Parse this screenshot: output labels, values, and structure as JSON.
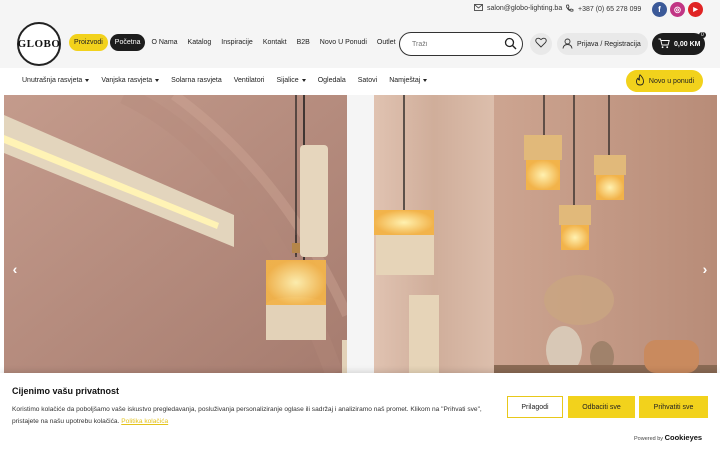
{
  "topbar": {
    "email": "salon@globo-lighting.ba",
    "phone": "+387 (0) 65 278 099",
    "social": [
      {
        "name": "facebook",
        "glyph": "f",
        "color": "#3b5998"
      },
      {
        "name": "instagram",
        "glyph": "◎",
        "color": "#c13584"
      },
      {
        "name": "youtube",
        "glyph": "▶",
        "color": "#e02424"
      }
    ]
  },
  "header": {
    "logo_text": "GLOBO",
    "nav": [
      {
        "label": "Proizvodi",
        "style": "yellow"
      },
      {
        "label": "Početna",
        "style": "dark"
      },
      {
        "label": "O Nama",
        "style": ""
      },
      {
        "label": "Katalog",
        "style": ""
      },
      {
        "label": "Inspiracije",
        "style": ""
      },
      {
        "label": "Kontakt",
        "style": ""
      },
      {
        "label": "B2B",
        "style": ""
      },
      {
        "label": "Novo U Ponudi",
        "style": ""
      },
      {
        "label": "Outlet",
        "style": ""
      }
    ],
    "search_placeholder": "Traži",
    "login_label": "Prijava / Registracija",
    "cart_label": "0,00 KM",
    "cart_count": "0"
  },
  "categories": [
    {
      "label": "Unutrašnja rasvjeta",
      "dropdown": true
    },
    {
      "label": "Vanjska rasvjeta",
      "dropdown": true
    },
    {
      "label": "Solarna rasvjeta",
      "dropdown": false
    },
    {
      "label": "Ventilatori",
      "dropdown": false
    },
    {
      "label": "Sijalice",
      "dropdown": true
    },
    {
      "label": "Ogledala",
      "dropdown": false
    },
    {
      "label": "Satovi",
      "dropdown": false
    },
    {
      "label": "Namještaj",
      "dropdown": true
    }
  ],
  "novo_button": "Novo u ponudi",
  "colors": {
    "accent": "#f2d21c",
    "dark": "#1d1d1d",
    "hero_left": "#b78e7f",
    "hero_right": "#c79a84"
  },
  "cookie": {
    "title": "Cijenimo vašu privatnost",
    "text": "Koristimo kolačiće da poboljšamo vaše iskustvo pregledavanja, posluživanja personaliziranje oglase ili sadržaj i analiziramo naš promet. Klikom na \"Prihvati sve\", pristajete na našu upotrebu kolačića.",
    "policy_link": "Politika kolačića",
    "customize": "Prilagodi",
    "reject": "Odbaciti sve",
    "accept": "Prihvatiti sve",
    "powered_prefix": "Powered by",
    "powered_brand": "Cookieyes"
  }
}
